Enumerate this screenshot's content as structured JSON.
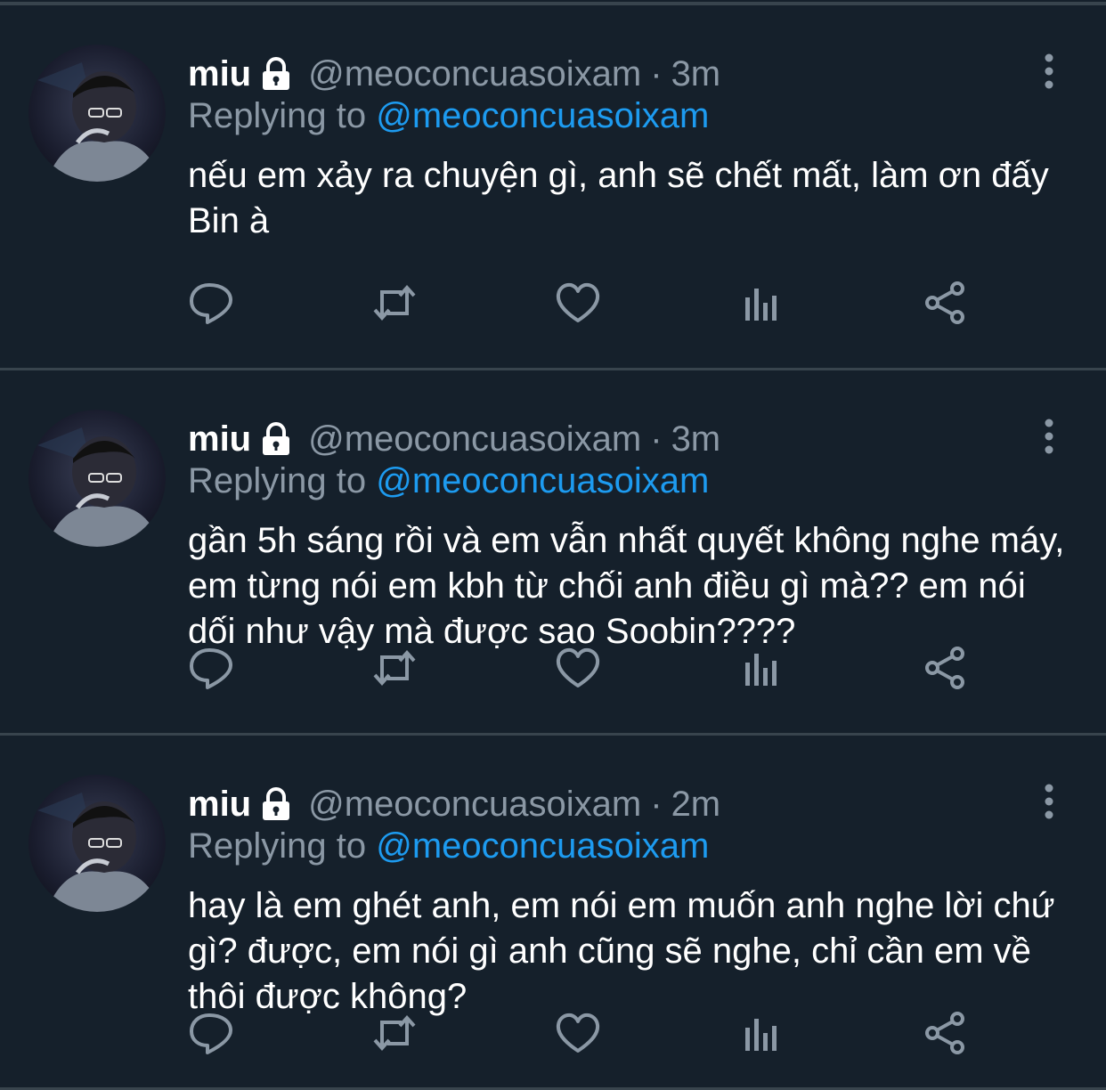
{
  "tweets": [
    {
      "name": "miu",
      "handle": "@meoconcuasoixam",
      "separator": "·",
      "time": "3m",
      "replying_prefix": "Replying to",
      "replying_to": "@meoconcuasoixam",
      "text": "nếu em xảy ra chuyện gì, anh sẽ chết mất, làm ơn đấy Bin à"
    },
    {
      "name": "miu",
      "handle": "@meoconcuasoixam",
      "separator": "·",
      "time": "3m",
      "replying_prefix": "Replying to",
      "replying_to": "@meoconcuasoixam",
      "text": "gần 5h sáng rồi và em vẫn nhất quyết không nghe máy, em từng nói em kbh từ chối anh điều gì mà?? em nói dối như vậy mà được sao Soobin????"
    },
    {
      "name": "miu",
      "handle": "@meoconcuasoixam",
      "separator": "·",
      "time": "2m",
      "replying_prefix": "Replying to",
      "replying_to": "@meoconcuasoixam",
      "text": "hay là em ghét anh, em nói em muốn anh nghe lời chứ gì? được, em nói gì anh cũng sẽ nghe, chỉ cần em về thôi được không?"
    }
  ],
  "icons": [
    "lock-icon",
    "more-icon",
    "reply-icon",
    "retweet-icon",
    "like-icon",
    "analytics-icon",
    "share-icon"
  ],
  "colors": {
    "background": "#15202b",
    "divider": "#38444d",
    "muted": "#8b98a5",
    "link": "#1d9bf0",
    "text": "#ffffff"
  }
}
